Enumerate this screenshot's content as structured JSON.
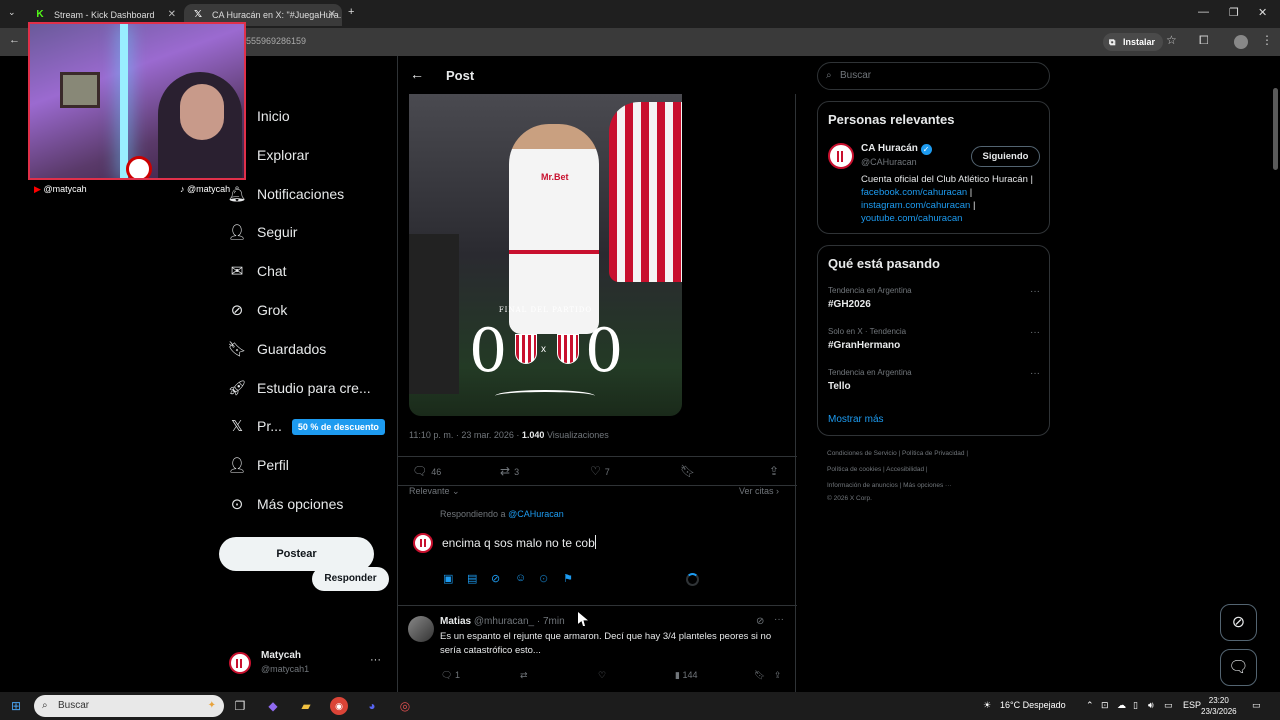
{
  "browser": {
    "tabs": [
      {
        "label": "Stream - Kick Dashboard",
        "icon": "kick-icon"
      },
      {
        "label": "CA Huracán en X: \"#JuegaHura...",
        "icon": "x-logo-icon"
      }
    ],
    "url": "555969286159",
    "install_label": "Instalar"
  },
  "overlay": {
    "youtube_handle": "@matycah",
    "tiktok_handle": "@matycah"
  },
  "nav": {
    "items": [
      {
        "label": "Inicio"
      },
      {
        "label": "Explorar"
      },
      {
        "label": "Notificaciones"
      },
      {
        "label": "Seguir"
      },
      {
        "label": "Chat"
      },
      {
        "label": "Grok"
      },
      {
        "label": "Guardados"
      },
      {
        "label": "Estudio para cre..."
      },
      {
        "label": "Pr..."
      },
      {
        "label": "Perfil"
      },
      {
        "label": "Más opciones"
      }
    ],
    "premium_badge": "50 % de descuento",
    "post_label": "Postear",
    "account_name": "Matycah",
    "account_handle": "@matycah1"
  },
  "post": {
    "header_title": "Post",
    "image": {
      "caption": "FINAL DEL PARTIDO",
      "score_home": "0",
      "score_away": "0",
      "sponsor": "Mr.Bet"
    },
    "time": "11:10 p. m. · 23 mar. 2026 · ",
    "views_count": "1.040",
    "views_label": " Visualizaciones",
    "replies": "46",
    "reposts": "3",
    "likes": "7",
    "sort_label": "Relevante",
    "quotes_label": "Ver citas",
    "replying_prefix": "Respondiendo a ",
    "replying_to": "@CAHuracan",
    "reply_text": "encima  q sos malo no te cob",
    "reply_button": "Responder"
  },
  "comment": {
    "name": "Matias",
    "handle": "@mhuracan_ · 7min",
    "text": "Es un espanto el rejunte que armaron. Decí que hay 3/4  planteles peores si no sería catastrófico esto...",
    "replies": "1",
    "views": "144"
  },
  "sidebar": {
    "search_placeholder": "Buscar",
    "relevant": {
      "title": "Personas relevantes",
      "name": "CA Huracán",
      "handle": "@CAHuracan",
      "follow_label": "Siguiendo",
      "bio_line1": "Cuenta oficial del Club Atlético Huracán | ",
      "link1": "facebook.com/cahuracan",
      "sep1": " | ",
      "link2": "instagram.com/cahuracan",
      "sep2": " | ",
      "link3": "youtube.com/cahuracan"
    },
    "trends": {
      "title": "Qué está pasando",
      "items": [
        {
          "context": "Tendencia en Argentina",
          "name": "#GH2026"
        },
        {
          "context": "Solo en X · Tendencia",
          "name": "#GranHermano"
        },
        {
          "context": "Tendencia en Argentina",
          "name": "Tello"
        }
      ],
      "show_more": "Mostrar más"
    },
    "footer": {
      "line1": "Condiciones de Servicio  |   Política de Privacidad  |",
      "line2": "Política de cookies  |   Accesibilidad  |",
      "line3": "Información de anuncios  |   Más opciones ···",
      "line4": "© 2026 X Corp."
    }
  },
  "taskbar": {
    "search_placeholder": "Buscar",
    "weather": "16°C  Despejado",
    "lang": "ESP",
    "time": "23:20",
    "date": "23/3/2026"
  },
  "colors": {
    "accent": "#1d9bf0",
    "huracan_red": "#c8102e",
    "border": "#2f3336"
  }
}
